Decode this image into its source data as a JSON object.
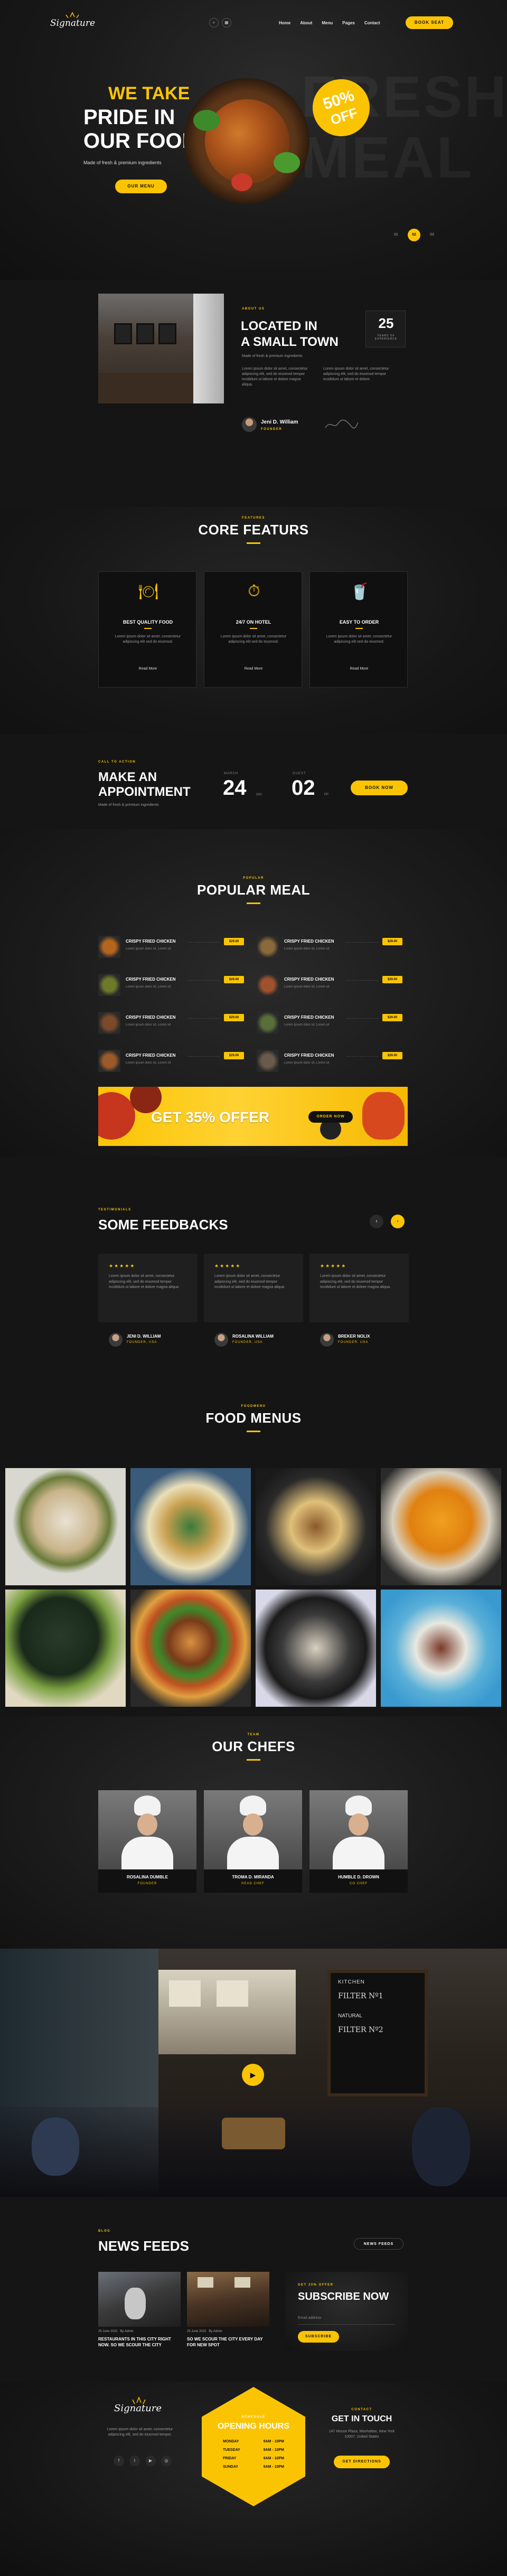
{
  "nav": {
    "logo": "Signature",
    "items": [
      "Home",
      "About",
      "Menu",
      "Pages",
      "Contact"
    ],
    "book": "BOOK SEAT"
  },
  "hero": {
    "line1": "WE TAKE",
    "line2": "PRIDE IN",
    "line3": "OUR FOOD",
    "sub": "Made of fresh & premium ingredients",
    "btn": "OUR MENU",
    "badge_num": "50%",
    "badge_off": "OFF",
    "bg_word1": "FRESH",
    "bg_word2": "MEAL",
    "slides": [
      "01",
      "02",
      "03"
    ]
  },
  "about": {
    "tag": "ABOUT US",
    "title1": "LOCATED IN",
    "title2": "A SMALL TOWN",
    "sub": "Made of fresh & premium ingredients",
    "years": "25",
    "years_label": "YEARS OF EXPERIENCE",
    "p1": "Lorem ipsum dolor sit amet, consectetur adipiscing elit, sed do eiusmod tempor incididunt ut labore et dolore magna aliqua.",
    "p2": "Lorem ipsum dolor sit amet, consectetur adipiscing elit, sed do eiusmod tempor incididunt ut labore et dolore.",
    "name": "Jeni D. William",
    "role": "FOUNDER"
  },
  "features": {
    "tag": "FEATURES",
    "title": "CORE FEATURS",
    "items": [
      {
        "name": "BEST QUALITY FOOD",
        "text": "Lorem ipsum dolor sit amet, consectetur adipiscing elit sed do eiusmod.",
        "link": "Read More"
      },
      {
        "name": "24/7 ON HOTEL",
        "text": "Lorem ipsum dolor sit amet, consectetur adipiscing elit sed do eiusmod.",
        "link": "Read More"
      },
      {
        "name": "EASY TO ORDER",
        "text": "Lorem ipsum dolor sit amet, consectetur adipiscing elit sed do eiusmod.",
        "link": "Read More"
      }
    ]
  },
  "appointment": {
    "tag": "CALL TO ACTION",
    "title1": "MAKE AN",
    "title2": "APPOINTMENT",
    "sub": "Made of fresh & premium ingredients",
    "date1_label": "MARCH",
    "date1": "24",
    "date1_sub": "JAN",
    "date2_label": "GUEST",
    "date2": "02",
    "date2_sub": "PP",
    "btn": "BOOK NOW"
  },
  "popular": {
    "tag": "POPULAR",
    "title": "POPULAR MEAL",
    "items": [
      {
        "name": "CRISPY FRIED CHICKEN",
        "desc": "Lorem ipsum dolor sit, Lorem sit",
        "price": "$29.00"
      },
      {
        "name": "CRISPY FRIED CHICKEN",
        "desc": "Lorem ipsum dolor sit, Lorem sit",
        "price": "$29.00"
      },
      {
        "name": "CRISPY FRIED CHICKEN",
        "desc": "Lorem ipsum dolor sit, Lorem sit",
        "price": "$29.00"
      },
      {
        "name": "CRISPY FRIED CHICKEN",
        "desc": "Lorem ipsum dolor sit, Lorem sit",
        "price": "$29.00"
      },
      {
        "name": "CRISPY FRIED CHICKEN",
        "desc": "Lorem ipsum dolor sit, Lorem sit",
        "price": "$29.00"
      },
      {
        "name": "CRISPY FRIED CHICKEN",
        "desc": "Lorem ipsum dolor sit, Lorem sit",
        "price": "$29.00"
      },
      {
        "name": "CRISPY FRIED CHICKEN",
        "desc": "Lorem ipsum dolor sit, Lorem sit",
        "price": "$29.00"
      },
      {
        "name": "CRISPY FRIED CHICKEN",
        "desc": "Lorem ipsum dolor sit, Lorem sit",
        "price": "$29.00"
      }
    ],
    "offer": "GET 35% OFFER",
    "offer_btn": "ORDER NOW"
  },
  "feedback": {
    "tag": "TESTIMONIALS",
    "title": "SOME FEEDBACKS",
    "stars": "★★★★★",
    "items": [
      {
        "text": "Lorem ipsum dolor sit amet, consectetur adipiscing elit, sed do eiusmod tempor incididunt ut labore et dolore magna aliqua.",
        "name": "JENI D. WILLIAM",
        "role": "FOUNDER, USA"
      },
      {
        "text": "Lorem ipsum dolor sit amet, consectetur adipiscing elit, sed do eiusmod tempor incididunt ut labore et dolore magna aliqua.",
        "name": "ROSALINA WILLIAM",
        "role": "FOUNDER, USA"
      },
      {
        "text": "Lorem ipsum dolor sit amet, consectetur adipiscing elit, sed do eiusmod tempor incididunt ut labore et dolore magna aliqua.",
        "name": "BREKER NOLIX",
        "role": "FOUNDER, USA"
      }
    ]
  },
  "food_menus": {
    "tag": "FOODMENU",
    "title": "FOOD MENUS"
  },
  "chefs": {
    "tag": "TEAM",
    "title": "OUR CHEFS",
    "items": [
      {
        "name": "ROSALINA DUMBLE",
        "role": "FOUNDER"
      },
      {
        "name": "TROMA D. MIRANDA",
        "role": "HEAD CHEF"
      },
      {
        "name": "HUMBLE D. DROWN",
        "role": "CO CHEF"
      }
    ]
  },
  "video": {
    "sign1": "KITCHEN",
    "sign2": "FILTER Nº1",
    "sign3": "FILTER Nº2",
    "sign4": "NATURAL"
  },
  "news": {
    "tag": "BLOG",
    "title": "NEWS FEEDS",
    "btn": "NEWS FEEDS",
    "posts": [
      {
        "date": "25 June 2022",
        "author": "By Admin",
        "title": "RESTAURANTS IN THIS CITY RIGHT NOW. SO WE SCOUR THE CITY"
      },
      {
        "date": "25 June 2022",
        "author": "By Admin",
        "title": "SO WE SCOUR THE CITY EVERY DAY FOR NEW SPOT"
      }
    ],
    "subscribe_tag": "GET 20% OFFER",
    "subscribe": "SUBSCRIBE NOW",
    "email_ph": "Email address",
    "sub_btn": "SUBSCRIBE"
  },
  "footer": {
    "logo": "Signature",
    "about": "Lorem ipsum dolor sit amet, consectetur adipiscing elit, sed do eiusmod tempor.",
    "hours_tag": "SCHEDULE",
    "hours_title": "OPENING HOURS",
    "hours": [
      {
        "d": "MONDAY",
        "t": "9AM - 10PM"
      },
      {
        "d": "TUESDAY",
        "t": "9AM - 10PM"
      },
      {
        "d": "FRIDAY",
        "t": "9AM - 10PM"
      },
      {
        "d": "SUNDAY",
        "t": "9AM - 10PM"
      }
    ],
    "contact_tag": "CONTACT",
    "contact_title": "GET IN TOUCH",
    "address": "147 Mouse Plaza, Manhattan, New York 10007, United States",
    "btn": "GET DIRECTIONS"
  }
}
